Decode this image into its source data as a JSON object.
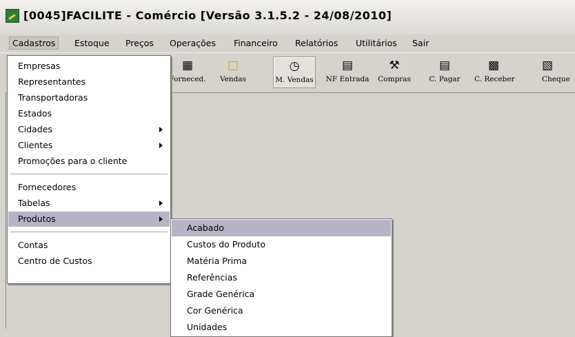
{
  "window": {
    "title": "[0045]FACILITE - Comércio [Versão 3.1.5.2 - 24/08/2010]",
    "icon": "app-logo-icon"
  },
  "menubar": {
    "items": [
      "Cadastros",
      "Estoque",
      "Preços",
      "Operações",
      "Financeiro",
      "Relatórios",
      "Utilitários",
      "Sair"
    ],
    "active": "Cadastros"
  },
  "toolbar": {
    "buttons": [
      {
        "label": "Forneced.",
        "icon": "supplier-icon"
      },
      {
        "label": "Vendas",
        "icon": "sales-icon"
      },
      {
        "label": "M. Vendas",
        "icon": "sales-clock-icon",
        "pressed": true
      },
      {
        "label": "NF Entrada",
        "icon": "invoice-entry-icon"
      },
      {
        "label": "Compras",
        "icon": "purchases-icon"
      },
      {
        "label": "C. Pagar",
        "icon": "payables-icon"
      },
      {
        "label": "C. Receber",
        "icon": "receivables-icon"
      },
      {
        "label": "Cheque",
        "icon": "check-icon"
      }
    ]
  },
  "cadastros_menu": {
    "items": [
      {
        "label": "Empresas",
        "submenu": false
      },
      {
        "label": "Representantes",
        "submenu": false
      },
      {
        "label": "Transportadoras",
        "submenu": false
      },
      {
        "label": "Estados",
        "submenu": false
      },
      {
        "label": "Cidades",
        "submenu": true
      },
      {
        "label": "Clientes",
        "submenu": true
      },
      {
        "label": "Promoções para o cliente",
        "submenu": false
      },
      {
        "label": "Fornecedores",
        "submenu": false
      },
      {
        "label": "Tabelas",
        "submenu": true
      },
      {
        "label": "Produtos",
        "submenu": true,
        "selected": true
      },
      {
        "label": "Contas",
        "submenu": false
      },
      {
        "label": "Centro de Custos",
        "submenu": false
      }
    ]
  },
  "produtos_submenu": {
    "items": [
      "Acabado",
      "Custos do Produto",
      "Matéria Prima",
      "Referências",
      "Grade Genérica",
      "Cor Genérica",
      "Unidades"
    ],
    "selected": "Acabado"
  },
  "colors": {
    "selection": "#b6b4c4",
    "background": "#d6d3ce"
  }
}
